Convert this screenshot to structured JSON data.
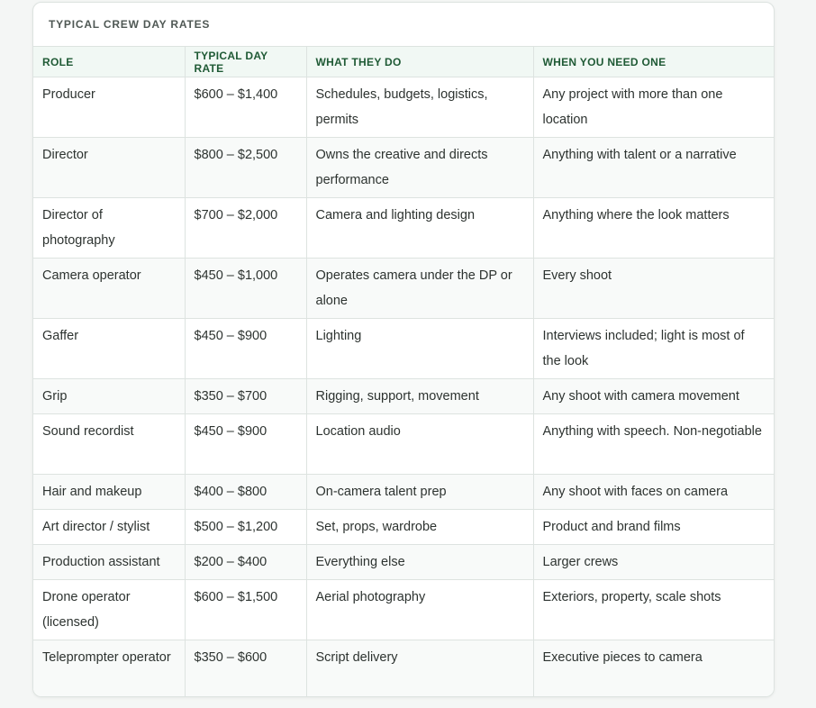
{
  "table": {
    "title": "TYPICAL CREW DAY RATES",
    "headers": [
      "ROLE",
      "TYPICAL DAY RATE",
      "WHAT THEY DO",
      "WHEN YOU NEED ONE"
    ],
    "rows": [
      [
        "Producer",
        "$600 – $1,400",
        "Schedules, budgets, logistics, permits",
        "Any project with more than one location"
      ],
      [
        "Director",
        "$800 – $2,500",
        "Owns the creative and directs performance",
        "Anything with talent or a narrative"
      ],
      [
        "Director of photography",
        "$700 – $2,000",
        "Camera and lighting design",
        "Anything where the look matters"
      ],
      [
        "Camera operator",
        "$450 – $1,000",
        "Operates camera under the DP or alone",
        "Every shoot"
      ],
      [
        "Gaffer",
        "$450 – $900",
        "Lighting",
        "Interviews included; light is most of the look"
      ],
      [
        "Grip",
        "$350 – $700",
        "Rigging, support, movement",
        "Any shoot with camera movement"
      ],
      [
        "Sound recordist",
        "$450 – $900",
        "Location audio",
        "Anything with speech. Non-negotiable"
      ],
      [
        "Hair and makeup",
        "$400 – $800",
        "On-camera talent prep",
        "Any shoot with faces on camera"
      ],
      [
        "Art director / stylist",
        "$500 – $1,200",
        "Set, props, wardrobe",
        "Product and brand films"
      ],
      [
        "Production assistant",
        "$200 – $400",
        "Everything else",
        "Larger crews"
      ],
      [
        "Drone operator (licensed)",
        "$600 – $1,500",
        "Aerial photography",
        "Exteriors, property, scale shots"
      ],
      [
        "Teleprompter operator",
        "$350 – $600",
        "Script delivery",
        "Executive pieces to camera"
      ]
    ]
  }
}
